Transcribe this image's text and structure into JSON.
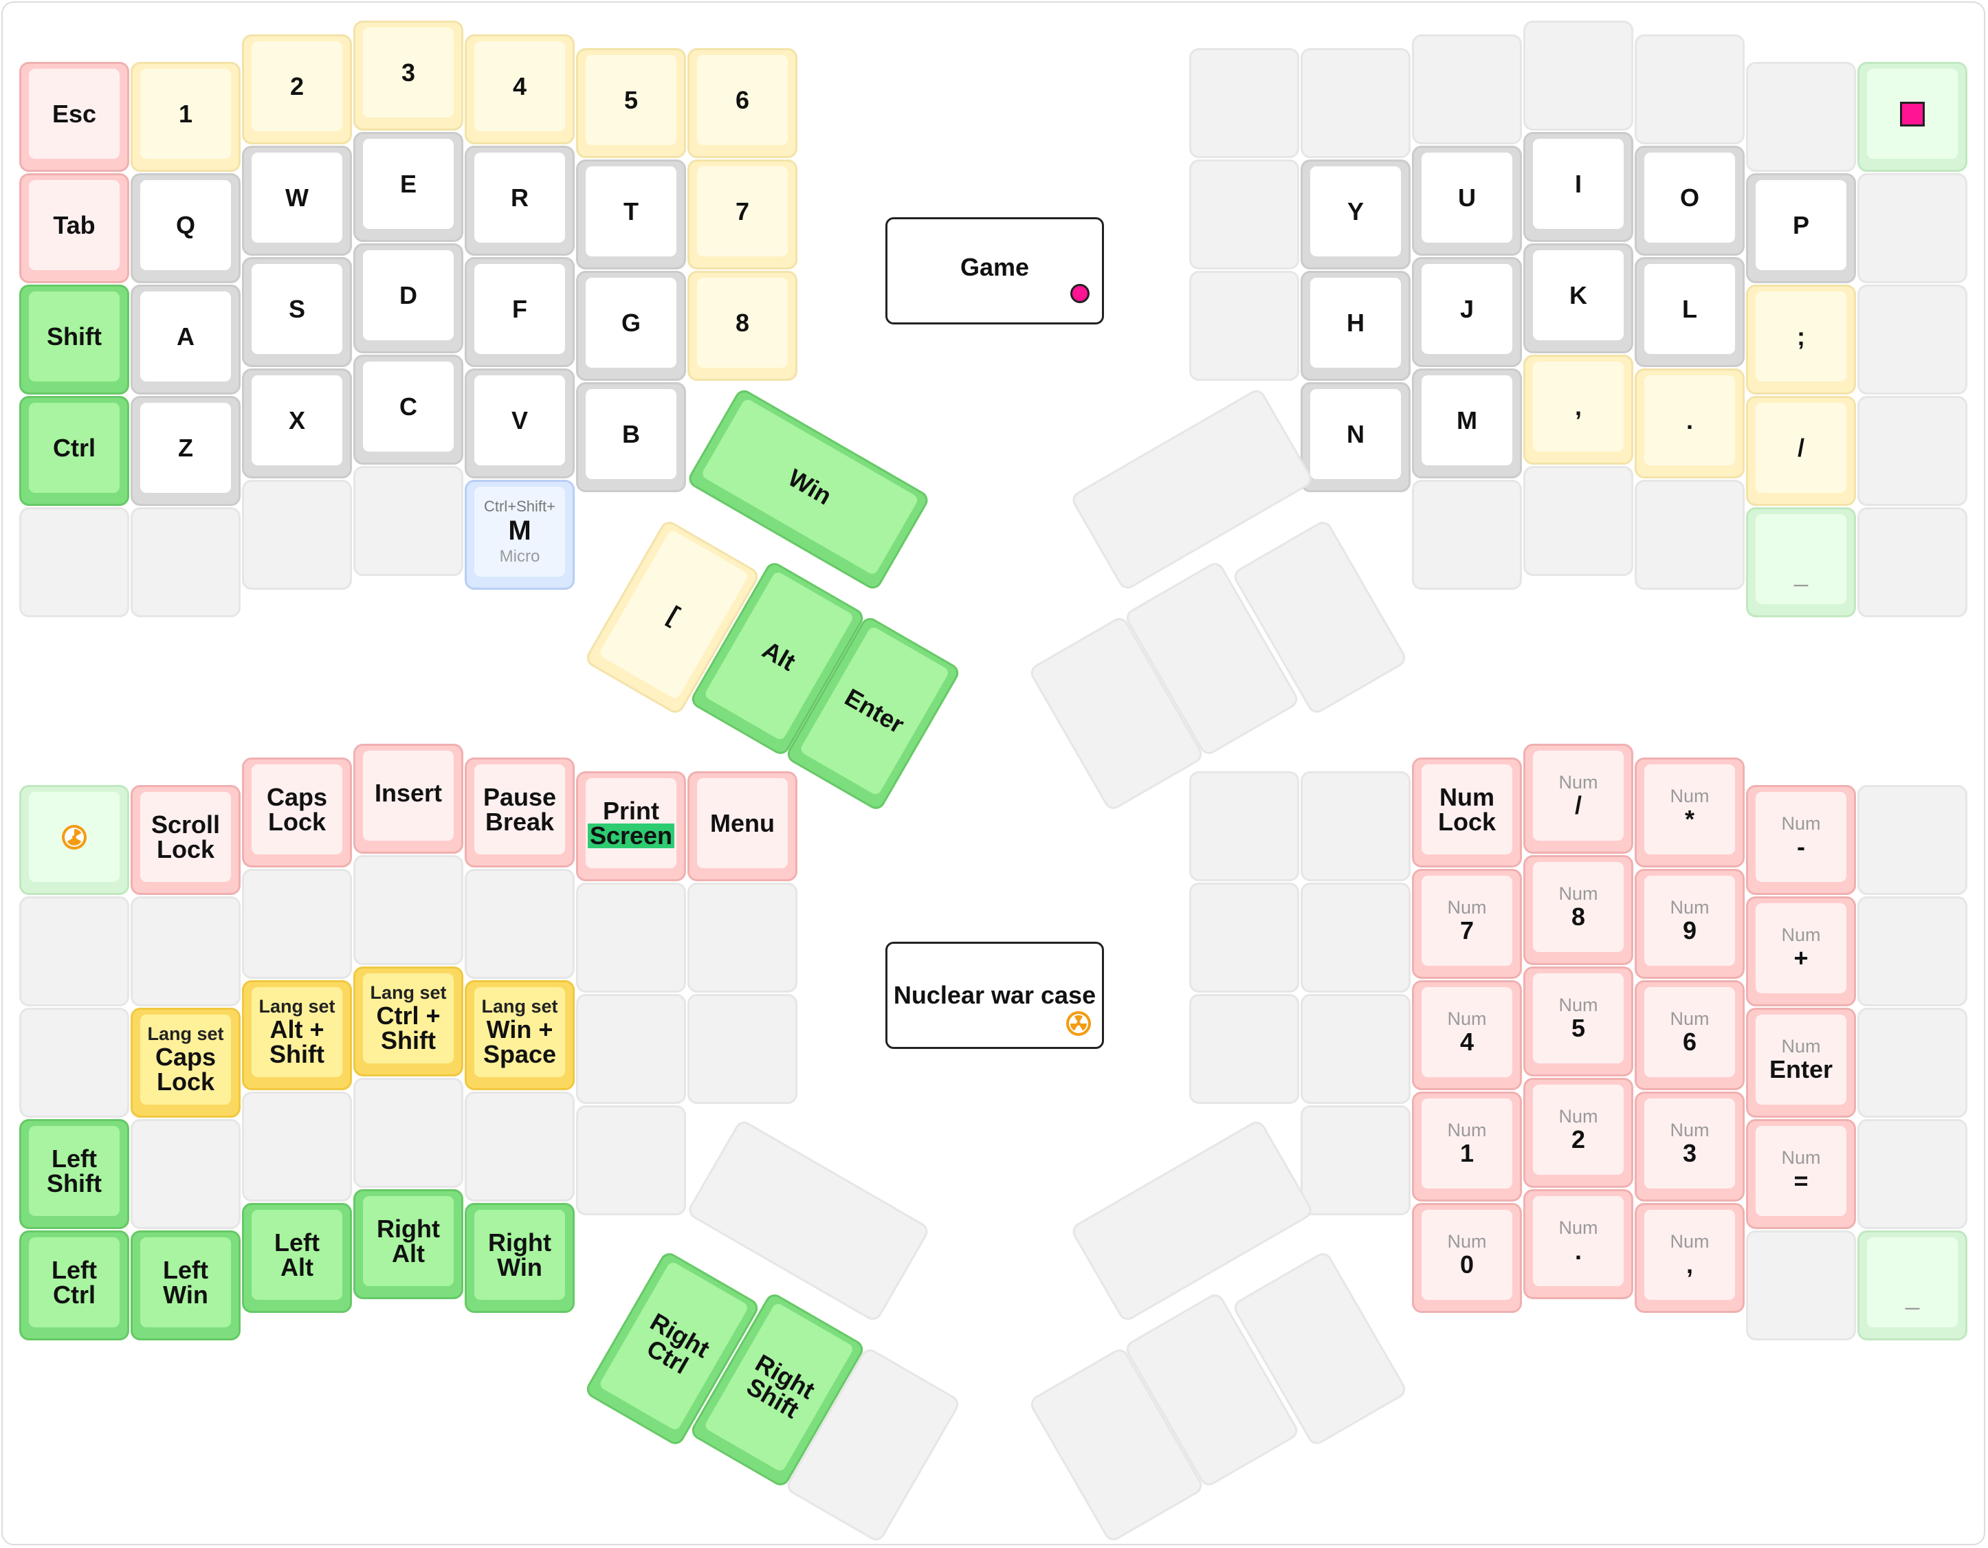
{
  "colors": {
    "red_layer": "#ffcccc",
    "yellow_layer": "#fff1c2",
    "green_layer": "#7dde7d",
    "light_green": "#d6f5d6",
    "blue_layer": "#d9e7ff",
    "gold_layer": "#fbd960",
    "empty_key": "#f2f2f2",
    "game_indicator": "#ff1493",
    "nuclear_indicator": "#f39c12",
    "print_screen_highlight": "#2ecc71"
  },
  "legends": {
    "game": "Game",
    "nuclear": "Nuclear war case"
  },
  "top_left": {
    "esc": "Esc",
    "tab": "Tab",
    "shift": "Shift",
    "ctrl": "Ctrl",
    "n1": "1",
    "n2": "2",
    "n3": "3",
    "n4": "4",
    "n5": "5",
    "n6": "6",
    "n7": "7",
    "n8": "8",
    "q": "Q",
    "w": "W",
    "e": "E",
    "r": "R",
    "t": "T",
    "a": "A",
    "s": "S",
    "d": "D",
    "f": "F",
    "g": "G",
    "z": "Z",
    "x": "X",
    "c": "C",
    "v": "V",
    "b": "B",
    "micro_top": "Ctrl+Shift+",
    "micro_main": "M",
    "micro_bottom": "Micro",
    "win": "Win",
    "bracket": "[",
    "alt": "Alt",
    "enter": "Enter"
  },
  "top_right": {
    "y": "Y",
    "u": "U",
    "i": "I",
    "o": "O",
    "p": "P",
    "h": "H",
    "j": "J",
    "k": "K",
    "l": "L",
    "semicolon": ";",
    "n": "N",
    "m": "M",
    "comma": ",",
    "period": ".",
    "slash": "/",
    "underscore": "_"
  },
  "bottom_left": {
    "scroll": "Scroll Lock",
    "caps": "Caps Lock",
    "insert": "Insert",
    "pause": "Pause Break",
    "print_top": "Print",
    "print_bottom": "Screen",
    "menu": "Menu",
    "lang_caps_top": "Lang set",
    "lang_caps_main": "Caps Lock",
    "lang_alt_top": "Lang set",
    "lang_alt_main": "Alt + Shift",
    "lang_ctrl_top": "Lang set",
    "lang_ctrl_main": "Ctrl + Shift",
    "lang_win_top": "Lang set",
    "lang_win_main": "Win + Space",
    "lshift": "Left Shift",
    "lctrl": "Left Ctrl",
    "lwin": "Left Win",
    "lalt": "Left Alt",
    "ralt": "Right Alt",
    "rwin": "Right Win",
    "rctrl": "Right Ctrl",
    "rshift": "Right Shift"
  },
  "bottom_right": {
    "num": "Num",
    "numlock": "Num Lock",
    "slash": "/",
    "star": "*",
    "minus": "-",
    "plus": "+",
    "enter": "Enter",
    "equal": "=",
    "n7": "7",
    "n8": "8",
    "n9": "9",
    "n4": "4",
    "n5": "5",
    "n6": "6",
    "n1": "1",
    "n2": "2",
    "n3": "3",
    "n0": "0",
    "dot": ".",
    "comma": ",",
    "underscore": "_"
  }
}
